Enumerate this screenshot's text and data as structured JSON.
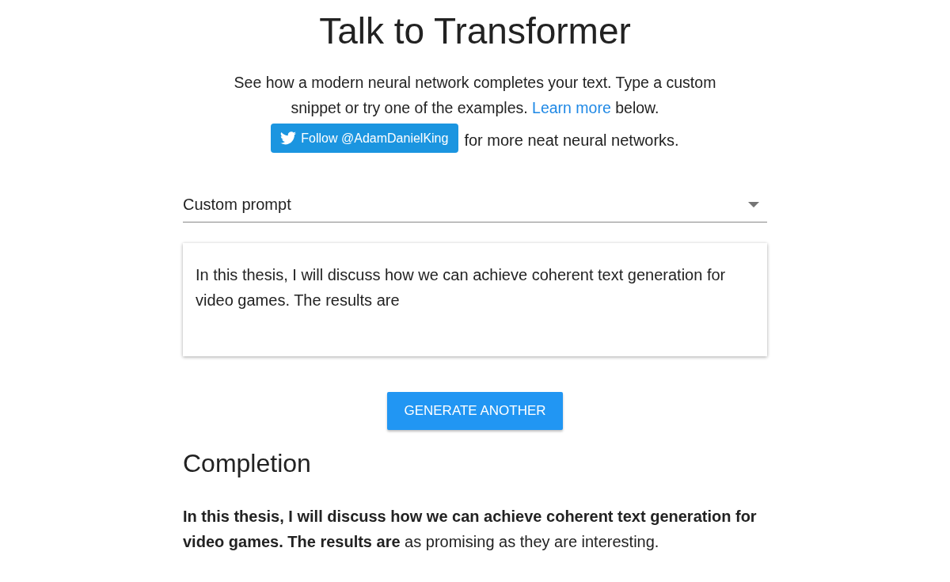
{
  "title": "Talk to Transformer",
  "intro": {
    "before": "See how a modern neural network completes your text. Type a custom snippet or try one of the examples. ",
    "link": "Learn more",
    "after": " below."
  },
  "follow": {
    "button": "Follow @AdamDanielKing",
    "suffix": "for more neat neural networks."
  },
  "dropdown": {
    "value": "Custom prompt"
  },
  "prompt": {
    "value": "In this thesis, I will discuss how we can achieve coherent text generation for video games. The results are"
  },
  "generate_button": "GENERATE ANOTHER",
  "completion": {
    "heading": "Completion",
    "text": "**In this thesis, I will discuss how we can achieve coherent text generation for video games. The results are** as promising as they are interesting."
  }
}
